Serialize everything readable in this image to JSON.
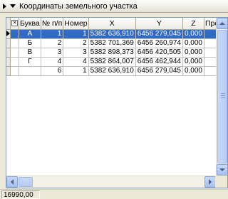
{
  "panel": {
    "title": "Координаты земельного участка"
  },
  "grid": {
    "columns": [
      "Буква",
      "№ п/п",
      "Номер",
      "X",
      "Y",
      "Z",
      "Пром.Ц"
    ],
    "rows": [
      {
        "letter": "А",
        "num": "1",
        "number": "1",
        "x": "5382 636,910",
        "y": "6456 279,045",
        "z": "0,000",
        "prom": "",
        "selected": true
      },
      {
        "letter": "Б",
        "num": "2",
        "number": "2",
        "x": "5382 701,369",
        "y": "6456 260,974",
        "z": "0,000",
        "prom": ""
      },
      {
        "letter": "В",
        "num": "3",
        "number": "3",
        "x": "5382 898,373",
        "y": "6456 420,505",
        "z": "0,000",
        "prom": ""
      },
      {
        "letter": "Г",
        "num": "4",
        "number": "4",
        "x": "5382 864,007",
        "y": "6456 462,944",
        "z": "0,000",
        "prom": ""
      },
      {
        "letter": "",
        "num": "6",
        "number": "1",
        "x": "5382 636,910",
        "y": "6456 279,045",
        "z": "0,000",
        "prom": ""
      }
    ]
  },
  "status": {
    "value": "16990,00"
  },
  "icons": {
    "header_expand": "triangle-right-icon",
    "header_collapse": "triangle-down-icon",
    "row_pointer": "row-pointer-icon",
    "select_all": "select-all-checkbox-icon"
  },
  "colors": {
    "selection": "#316ac5",
    "background": "#ece9d8",
    "scrollbar": "#b7cdf5"
  }
}
